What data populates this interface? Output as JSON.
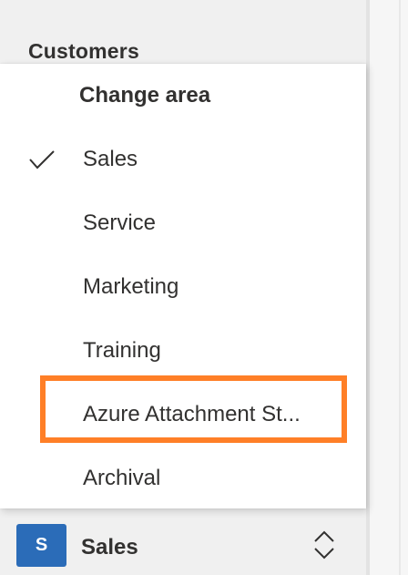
{
  "sidebar": {
    "heading": "Customers"
  },
  "area_menu": {
    "title": "Change area",
    "items": [
      {
        "label": "Sales",
        "checked": true
      },
      {
        "label": "Service",
        "checked": false
      },
      {
        "label": "Marketing",
        "checked": false
      },
      {
        "label": "Training",
        "checked": false
      },
      {
        "label": "Azure Attachment St...",
        "checked": false,
        "highlighted": true
      },
      {
        "label": "Archival",
        "checked": false
      }
    ]
  },
  "area_switcher": {
    "avatar_initial": "S",
    "current_area": "Sales",
    "icon": "chevron-up-down-icon"
  },
  "colors": {
    "highlight": "#ff7f27",
    "avatar": "#2b6cb8",
    "text": "#323130"
  }
}
